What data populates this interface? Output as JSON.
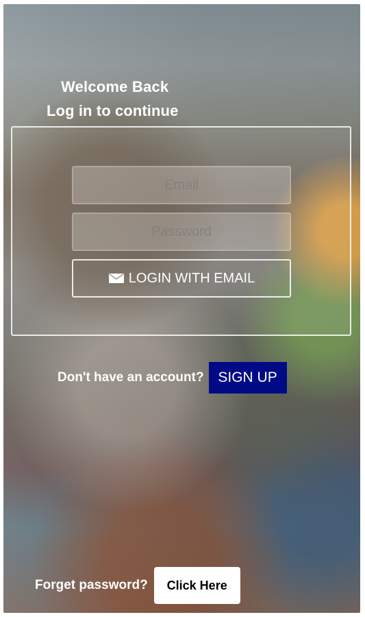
{
  "header": {
    "title": "Welcome Back",
    "subtitle": "Log in to continue"
  },
  "form": {
    "email_placeholder": "Email",
    "password_placeholder": "Password",
    "login_button_label": "LOGIN WITH EMAIL",
    "login_icon": "mail-icon"
  },
  "signup": {
    "prompt": "Don't have an account?",
    "button_label": "SIGN UP",
    "button_color": "#000a86"
  },
  "forgot": {
    "prompt": "Forget password?",
    "button_label": "Click Here"
  }
}
